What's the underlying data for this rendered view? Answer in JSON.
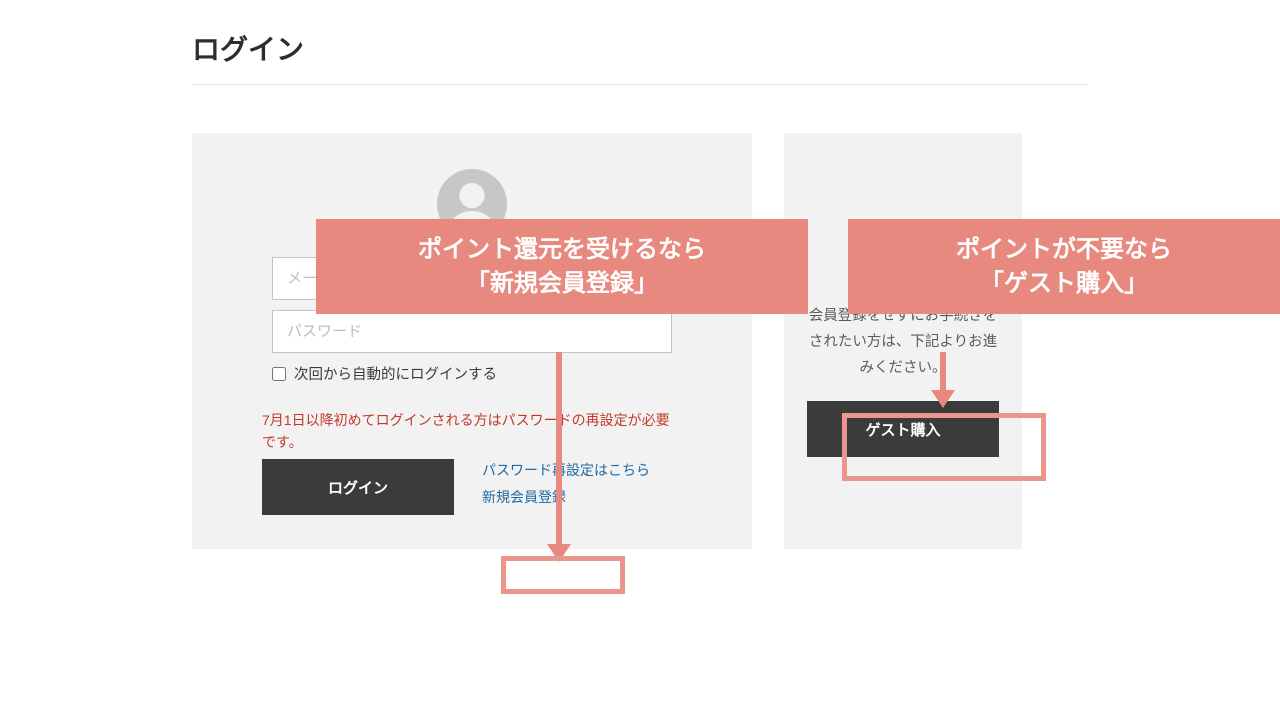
{
  "page_title": "ログイン",
  "login": {
    "email_placeholder": "メールアドレス",
    "password_placeholder": "パスワード",
    "auto_login_label": "次回から自動的にログインする",
    "notice": "7月1日以降初めてログインされる方はパスワードの再設定が必要です。",
    "login_button": "ログイン",
    "reset_link": "パスワード再設定はこちら",
    "register_link": "新規会員登録"
  },
  "guest": {
    "text": "会員登録をせずにお手続きをされたい方は、下記よりお進みください。",
    "button": "ゲスト購入"
  },
  "callouts": {
    "left_line1": "ポイント還元を受けるなら",
    "left_line2": "「新規会員登録」",
    "right_line1": "ポイントが不要なら",
    "right_line2": "「ゲスト購入」"
  }
}
